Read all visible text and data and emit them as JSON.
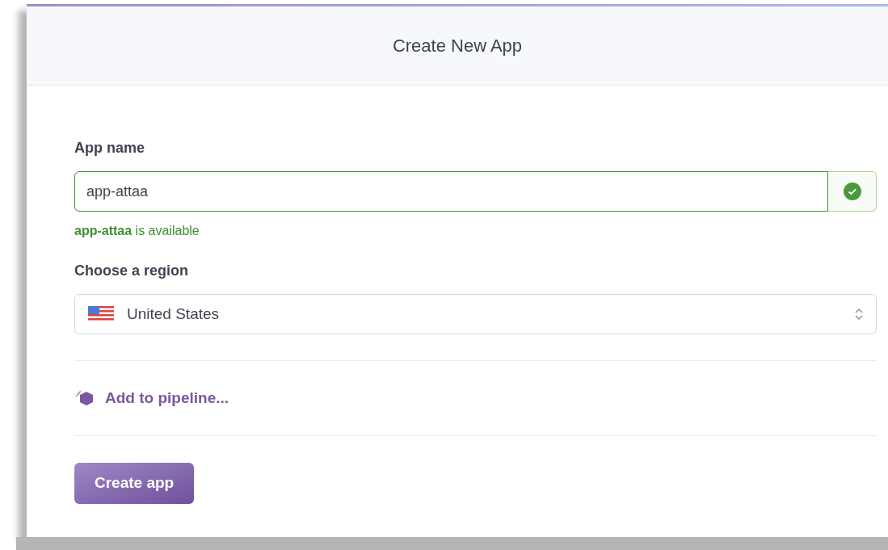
{
  "dialog": {
    "title": "Create New App"
  },
  "app_name": {
    "label": "App name",
    "value": "app-attaa",
    "valid": true,
    "message": "**app-attaa** is available"
  },
  "region": {
    "label": "Choose a region",
    "value": "United States"
  },
  "pipeline_link": "Add to pipeline...",
  "submit_button": "Create app"
}
